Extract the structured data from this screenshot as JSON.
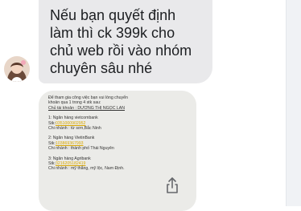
{
  "message": {
    "lines": [
      "Nếu bạn quyết định",
      "làm thì ck 399k cho",
      "chủ web rồi vào nhóm",
      "chuyên sâu nhé"
    ]
  },
  "image_attachment": {
    "intro": "Để tham gia công việc bạn vui   lòng chuyển",
    "intro2": "khoản qua 1 trong 4 stk sau:",
    "owner": "Chủ tài khoản : DƯƠNG THỊ NGỌC LAN",
    "banks": [
      {
        "name": "1: Ngân hàng vietcombank",
        "stk_label": "Stk:",
        "stk": "0351000902952",
        "branch": "Chi nhánh : từ sơn,Bắc Ninh"
      },
      {
        "name": "2: Ngân hàng VietinBank",
        "stk_label": "Stk:",
        "stk": "103869367993",
        "branch": "Chi nhánh : thành phố Thái Nguyên"
      },
      {
        "name": "3: Ngân hàng Agribank",
        "stk_label": "Stk:",
        "stk": "3216205182419",
        "branch": "Chi nhánh : mỹ thắng, mỹ lộc, Nam Định."
      }
    ]
  },
  "icons": {
    "share": "share-icon",
    "avatar": "avatar"
  }
}
